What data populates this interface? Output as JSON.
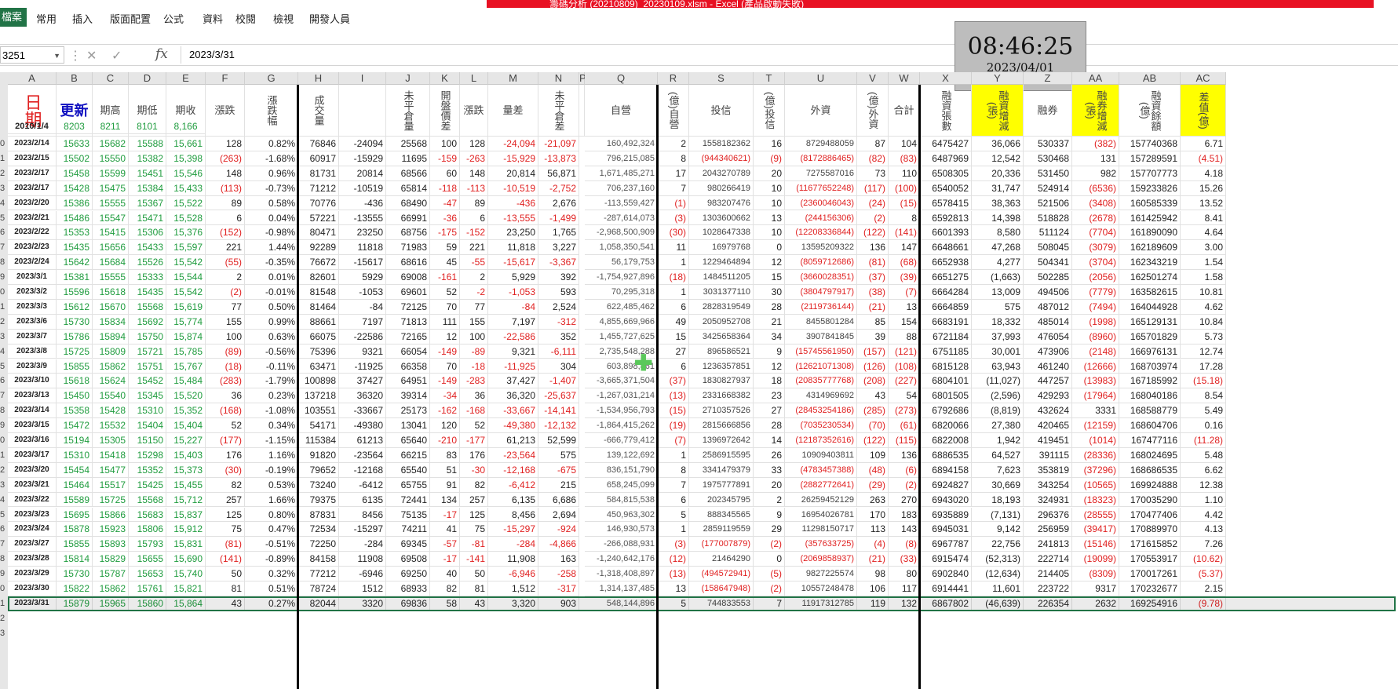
{
  "window": {
    "title": "籌碼分析 (20210809)_20230109.xlsm - Excel (產品啟動失敗)"
  },
  "ribbon": {
    "file": "檔案",
    "tabs": [
      "常用",
      "插入",
      "版面配置",
      "公式",
      "資料",
      "校閱",
      "檢視",
      "開發人員"
    ]
  },
  "formula_bar": {
    "name_box": "3251",
    "value": "2023/3/31",
    "fx": "fx"
  },
  "clock": {
    "time": "08:46:25",
    "date": "2023/04/01"
  },
  "columns": [
    "A",
    "B",
    "C",
    "D",
    "E",
    "F",
    "G",
    "H",
    "I",
    "J",
    "K",
    "L",
    "M",
    "N",
    "P",
    "Q",
    "R",
    "S",
    "T",
    "U",
    "V",
    "W",
    "X",
    "Y",
    "Z",
    "AA",
    "AB",
    "AC"
  ],
  "headers": {
    "A": "日期",
    "B": "更新",
    "C": "期高",
    "D": "期低",
    "E": "期收",
    "F": "漲跌",
    "G": "漲跌幅",
    "H": "成交量",
    "I": "",
    "J": "未平倉量",
    "K": "開盤價差",
    "L": "漲跌",
    "M": "量差",
    "N": "未平倉差",
    "Q": "自營",
    "R": "(億)自營",
    "S": "投信",
    "T": "(億)投信",
    "U": "外資",
    "V": "(億)外資",
    "W": "合計",
    "X": "融資張數",
    "Y": "融資增減(張)",
    "Z": "融券",
    "AA": "融券增減(張)",
    "AB": "融資餘額(億)",
    "AC": "差值(億)"
  },
  "base_row": {
    "date": "2010/1/4",
    "B": "8203",
    "C": "8211",
    "D": "8101",
    "E": "8,166"
  },
  "rows": [
    {
      "n": "0",
      "d": "2023/2/14",
      "v": [
        "15633",
        "15682",
        "15588",
        "15,661",
        "128",
        "0.82%",
        "76846",
        "-24094",
        "25568",
        "100",
        "128",
        "-24,094",
        "-21,097",
        "160,492,324",
        "2",
        "1558182362",
        "16",
        "8729488059",
        "87",
        "104",
        "6475427",
        "36,066",
        "530337",
        "(382)",
        "157740368",
        "6.71"
      ]
    },
    {
      "n": "1",
      "d": "2023/2/15",
      "v": [
        "15502",
        "15550",
        "15382",
        "15,398",
        "(263)",
        "-1.68%",
        "60917",
        "-15929",
        "11695",
        "-159",
        "-263",
        "-15,929",
        "-13,873",
        "796,215,085",
        "8",
        "(944340621)",
        "(9)",
        "(8172886465)",
        "(82)",
        "(83)",
        "6487969",
        "12,542",
        "530468",
        "131",
        "157289591",
        "(4.51)"
      ]
    },
    {
      "n": "2",
      "d": "2023/2/17",
      "v": [
        "15458",
        "15599",
        "15451",
        "15,546",
        "148",
        "0.96%",
        "81731",
        "20814",
        "68566",
        "60",
        "148",
        "20,814",
        "56,871",
        "1,671,485,271",
        "17",
        "2043270789",
        "20",
        "7275587016",
        "73",
        "110",
        "6508305",
        "20,336",
        "531450",
        "982",
        "157707773",
        "4.18"
      ]
    },
    {
      "n": "3",
      "d": "2023/2/17",
      "v": [
        "15428",
        "15475",
        "15384",
        "15,433",
        "(113)",
        "-0.73%",
        "71212",
        "-10519",
        "65814",
        "-118",
        "-113",
        "-10,519",
        "-2,752",
        "706,237,160",
        "7",
        "980266419",
        "10",
        "(11677652248)",
        "(117)",
        "(100)",
        "6540052",
        "31,747",
        "524914",
        "(6536)",
        "159233826",
        "15.26"
      ]
    },
    {
      "n": "4",
      "d": "2023/2/20",
      "v": [
        "15386",
        "15555",
        "15367",
        "15,522",
        "89",
        "0.58%",
        "70776",
        "-436",
        "68490",
        "-47",
        "89",
        "-436",
        "2,676",
        "-113,559,427",
        "(1)",
        "983207476",
        "10",
        "(2360046043)",
        "(24)",
        "(15)",
        "6578415",
        "38,363",
        "521506",
        "(3408)",
        "160585339",
        "13.52"
      ]
    },
    {
      "n": "5",
      "d": "2023/2/21",
      "v": [
        "15486",
        "15547",
        "15471",
        "15,528",
        "6",
        "0.04%",
        "57221",
        "-13555",
        "66991",
        "-36",
        "6",
        "-13,555",
        "-1,499",
        "-287,614,073",
        "(3)",
        "1303600662",
        "13",
        "(244156306)",
        "(2)",
        "8",
        "6592813",
        "14,398",
        "518828",
        "(2678)",
        "161425942",
        "8.41"
      ]
    },
    {
      "n": "6",
      "d": "2023/2/22",
      "v": [
        "15353",
        "15415",
        "15306",
        "15,376",
        "(152)",
        "-0.98%",
        "80471",
        "23250",
        "68756",
        "-175",
        "-152",
        "23,250",
        "1,765",
        "-2,968,500,909",
        "(30)",
        "1028647338",
        "10",
        "(12208336844)",
        "(122)",
        "(141)",
        "6601393",
        "8,580",
        "511124",
        "(7704)",
        "161890090",
        "4.64"
      ]
    },
    {
      "n": "7",
      "d": "2023/2/23",
      "v": [
        "15435",
        "15656",
        "15433",
        "15,597",
        "221",
        "1.44%",
        "92289",
        "11818",
        "71983",
        "59",
        "221",
        "11,818",
        "3,227",
        "1,058,350,541",
        "11",
        "16979768",
        "0",
        "13595209322",
        "136",
        "147",
        "6648661",
        "47,268",
        "508045",
        "(3079)",
        "162189609",
        "3.00"
      ]
    },
    {
      "n": "8",
      "d": "2023/2/24",
      "v": [
        "15642",
        "15684",
        "15526",
        "15,542",
        "(55)",
        "-0.35%",
        "76672",
        "-15617",
        "68616",
        "45",
        "-55",
        "-15,617",
        "-3,367",
        "56,179,753",
        "1",
        "1229464894",
        "12",
        "(8059712686)",
        "(81)",
        "(68)",
        "6652938",
        "4,277",
        "504341",
        "(3704)",
        "162343219",
        "1.54"
      ]
    },
    {
      "n": "9",
      "d": "2023/3/1",
      "v": [
        "15381",
        "15555",
        "15333",
        "15,544",
        "2",
        "0.01%",
        "82601",
        "5929",
        "69008",
        "-161",
        "2",
        "5,929",
        "392",
        "-1,754,927,896",
        "(18)",
        "1484511205",
        "15",
        "(3660028351)",
        "(37)",
        "(39)",
        "6651275",
        "(1,663)",
        "502285",
        "(2056)",
        "162501274",
        "1.58"
      ]
    },
    {
      "n": "0",
      "d": "2023/3/2",
      "v": [
        "15596",
        "15618",
        "15435",
        "15,542",
        "(2)",
        "-0.01%",
        "81548",
        "-1053",
        "69601",
        "52",
        "-2",
        "-1,053",
        "593",
        "70,295,318",
        "1",
        "3031377110",
        "30",
        "(3804797917)",
        "(38)",
        "(7)",
        "6664284",
        "13,009",
        "494506",
        "(7779)",
        "163582615",
        "10.81"
      ]
    },
    {
      "n": "1",
      "d": "2023/3/3",
      "v": [
        "15612",
        "15670",
        "15568",
        "15,619",
        "77",
        "0.50%",
        "81464",
        "-84",
        "72125",
        "70",
        "77",
        "-84",
        "2,524",
        "622,485,462",
        "6",
        "2828319549",
        "28",
        "(2119736144)",
        "(21)",
        "13",
        "6664859",
        "575",
        "487012",
        "(7494)",
        "164044928",
        "4.62"
      ]
    },
    {
      "n": "2",
      "d": "2023/3/6",
      "v": [
        "15730",
        "15834",
        "15692",
        "15,774",
        "155",
        "0.99%",
        "88661",
        "7197",
        "71813",
        "111",
        "155",
        "7,197",
        "-312",
        "4,855,669,966",
        "49",
        "2050952708",
        "21",
        "8455801284",
        "85",
        "154",
        "6683191",
        "18,332",
        "485014",
        "(1998)",
        "165129131",
        "10.84"
      ]
    },
    {
      "n": "3",
      "d": "2023/3/7",
      "v": [
        "15786",
        "15894",
        "15750",
        "15,874",
        "100",
        "0.63%",
        "66075",
        "-22586",
        "72165",
        "12",
        "100",
        "-22,586",
        "352",
        "1,455,727,625",
        "15",
        "3425658364",
        "34",
        "3907841845",
        "39",
        "88",
        "6721184",
        "37,993",
        "476054",
        "(8960)",
        "165701829",
        "5.73"
      ]
    },
    {
      "n": "4",
      "d": "2023/3/8",
      "v": [
        "15725",
        "15809",
        "15721",
        "15,785",
        "(89)",
        "-0.56%",
        "75396",
        "9321",
        "66054",
        "-149",
        "-89",
        "9,321",
        "-6,111",
        "2,735,548,288",
        "27",
        "896586521",
        "9",
        "(15745561950)",
        "(157)",
        "(121)",
        "6751185",
        "30,001",
        "473906",
        "(2148)",
        "166976131",
        "12.74"
      ]
    },
    {
      "n": "5",
      "d": "2023/3/9",
      "v": [
        "15855",
        "15862",
        "15751",
        "15,767",
        "(18)",
        "-0.11%",
        "63471",
        "-11925",
        "66358",
        "70",
        "-18",
        "-11,925",
        "304",
        "603,898,861",
        "6",
        "1236357851",
        "12",
        "(12621071308)",
        "(126)",
        "(108)",
        "6815128",
        "63,943",
        "461240",
        "(12666)",
        "168703974",
        "17.28"
      ]
    },
    {
      "n": "6",
      "d": "2023/3/10",
      "v": [
        "15618",
        "15624",
        "15452",
        "15,484",
        "(283)",
        "-1.79%",
        "100898",
        "37427",
        "64951",
        "-149",
        "-283",
        "37,427",
        "-1,407",
        "-3,665,371,504",
        "(37)",
        "1830827937",
        "18",
        "(20835777768)",
        "(208)",
        "(227)",
        "6804101",
        "(11,027)",
        "447257",
        "(13983)",
        "167185992",
        "(15.18)"
      ]
    },
    {
      "n": "7",
      "d": "2023/3/13",
      "v": [
        "15450",
        "15540",
        "15345",
        "15,520",
        "36",
        "0.23%",
        "137218",
        "36320",
        "39314",
        "-34",
        "36",
        "36,320",
        "-25,637",
        "-1,267,031,214",
        "(13)",
        "2331668382",
        "23",
        "4314969692",
        "43",
        "54",
        "6801505",
        "(2,596)",
        "429293",
        "(17964)",
        "168040186",
        "8.54"
      ]
    },
    {
      "n": "8",
      "d": "2023/3/14",
      "v": [
        "15358",
        "15428",
        "15310",
        "15,352",
        "(168)",
        "-1.08%",
        "103551",
        "-33667",
        "25173",
        "-162",
        "-168",
        "-33,667",
        "-14,141",
        "-1,534,956,793",
        "(15)",
        "2710357526",
        "27",
        "(28453254186)",
        "(285)",
        "(273)",
        "6792686",
        "(8,819)",
        "432624",
        "3331",
        "168588779",
        "5.49"
      ]
    },
    {
      "n": "9",
      "d": "2023/3/15",
      "v": [
        "15472",
        "15532",
        "15404",
        "15,404",
        "52",
        "0.34%",
        "54171",
        "-49380",
        "13041",
        "120",
        "52",
        "-49,380",
        "-12,132",
        "-1,864,415,262",
        "(19)",
        "2815666856",
        "28",
        "(7035230534)",
        "(70)",
        "(61)",
        "6820066",
        "27,380",
        "420465",
        "(12159)",
        "168604706",
        "0.16"
      ]
    },
    {
      "n": "0",
      "d": "2023/3/16",
      "v": [
        "15194",
        "15305",
        "15150",
        "15,227",
        "(177)",
        "-1.15%",
        "115384",
        "61213",
        "65640",
        "-210",
        "-177",
        "61,213",
        "52,599",
        "-666,779,412",
        "(7)",
        "1396972642",
        "14",
        "(12187352616)",
        "(122)",
        "(115)",
        "6822008",
        "1,942",
        "419451",
        "(1014)",
        "167477116",
        "(11.28)"
      ]
    },
    {
      "n": "1",
      "d": "2023/3/17",
      "v": [
        "15310",
        "15418",
        "15298",
        "15,403",
        "176",
        "1.16%",
        "91820",
        "-23564",
        "66215",
        "83",
        "176",
        "-23,564",
        "575",
        "139,122,692",
        "1",
        "2586915595",
        "26",
        "10909403811",
        "109",
        "136",
        "6886535",
        "64,527",
        "391115",
        "(28336)",
        "168024695",
        "5.48"
      ]
    },
    {
      "n": "2",
      "d": "2023/3/20",
      "v": [
        "15454",
        "15477",
        "15352",
        "15,373",
        "(30)",
        "-0.19%",
        "79652",
        "-12168",
        "65540",
        "51",
        "-30",
        "-12,168",
        "-675",
        "836,151,790",
        "8",
        "3341479379",
        "33",
        "(4783457388)",
        "(48)",
        "(6)",
        "6894158",
        "7,623",
        "353819",
        "(37296)",
        "168686535",
        "6.62"
      ]
    },
    {
      "n": "3",
      "d": "2023/3/21",
      "v": [
        "15464",
        "15517",
        "15425",
        "15,455",
        "82",
        "0.53%",
        "73240",
        "-6412",
        "65755",
        "91",
        "82",
        "-6,412",
        "215",
        "658,245,099",
        "7",
        "1975777891",
        "20",
        "(2882772641)",
        "(29)",
        "(2)",
        "6924827",
        "30,669",
        "343254",
        "(10565)",
        "169924888",
        "12.38"
      ]
    },
    {
      "n": "4",
      "d": "2023/3/22",
      "v": [
        "15589",
        "15725",
        "15568",
        "15,712",
        "257",
        "1.66%",
        "79375",
        "6135",
        "72441",
        "134",
        "257",
        "6,135",
        "6,686",
        "584,815,538",
        "6",
        "202345795",
        "2",
        "26259452129",
        "263",
        "270",
        "6943020",
        "18,193",
        "324931",
        "(18323)",
        "170035290",
        "1.10"
      ]
    },
    {
      "n": "5",
      "d": "2023/3/23",
      "v": [
        "15695",
        "15866",
        "15683",
        "15,837",
        "125",
        "0.80%",
        "87831",
        "8456",
        "75135",
        "-17",
        "125",
        "8,456",
        "2,694",
        "450,963,302",
        "5",
        "888345565",
        "9",
        "16954026781",
        "170",
        "183",
        "6935889",
        "(7,131)",
        "296376",
        "(28555)",
        "170477406",
        "4.42"
      ]
    },
    {
      "n": "6",
      "d": "2023/3/24",
      "v": [
        "15878",
        "15923",
        "15806",
        "15,912",
        "75",
        "0.47%",
        "72534",
        "-15297",
        "74211",
        "41",
        "75",
        "-15,297",
        "-924",
        "146,930,573",
        "1",
        "2859119559",
        "29",
        "11298150717",
        "113",
        "143",
        "6945031",
        "9,142",
        "256959",
        "(39417)",
        "170889970",
        "4.13"
      ]
    },
    {
      "n": "7",
      "d": "2023/3/27",
      "v": [
        "15855",
        "15893",
        "15793",
        "15,831",
        "(81)",
        "-0.51%",
        "72250",
        "-284",
        "69345",
        "-57",
        "-81",
        "-284",
        "-4,866",
        "-266,088,931",
        "(3)",
        "(177007879)",
        "(2)",
        "(357633725)",
        "(4)",
        "(8)",
        "6967787",
        "22,756",
        "241813",
        "(15146)",
        "171615852",
        "7.26"
      ]
    },
    {
      "n": "8",
      "d": "2023/3/28",
      "v": [
        "15814",
        "15829",
        "15655",
        "15,690",
        "(141)",
        "-0.89%",
        "84158",
        "11908",
        "69508",
        "-17",
        "-141",
        "11,908",
        "163",
        "-1,240,642,176",
        "(12)",
        "21464290",
        "0",
        "(2069858937)",
        "(21)",
        "(33)",
        "6915474",
        "(52,313)",
        "222714",
        "(19099)",
        "170553917",
        "(10.62)"
      ]
    },
    {
      "n": "9",
      "d": "2023/3/29",
      "v": [
        "15730",
        "15787",
        "15653",
        "15,740",
        "50",
        "0.32%",
        "77212",
        "-6946",
        "69250",
        "40",
        "50",
        "-6,946",
        "-258",
        "-1,318,408,897",
        "(13)",
        "(494572941)",
        "(5)",
        "9827225574",
        "98",
        "80",
        "6902840",
        "(12,634)",
        "214405",
        "(8309)",
        "170017261",
        "(5.37)"
      ]
    },
    {
      "n": "0",
      "d": "2023/3/30",
      "v": [
        "15822",
        "15862",
        "15761",
        "15,821",
        "81",
        "0.51%",
        "78724",
        "1512",
        "68933",
        "82",
        "81",
        "1,512",
        "-317",
        "1,314,137,485",
        "13",
        "(158647948)",
        "(2)",
        "10557248478",
        "106",
        "117",
        "6914441",
        "11,601",
        "223722",
        "9317",
        "170232677",
        "2.15"
      ]
    },
    {
      "n": "1",
      "d": "2023/3/31",
      "v": [
        "15879",
        "15965",
        "15860",
        "15,864",
        "43",
        "0.27%",
        "82044",
        "3320",
        "69836",
        "58",
        "43",
        "3,320",
        "903",
        "548,144,896",
        "5",
        "744833553",
        "7",
        "11917312785",
        "119",
        "132",
        "6867802",
        "(46,639)",
        "226354",
        "2632",
        "169254916",
        "(9.78)"
      ]
    }
  ],
  "tail_rows": [
    "2",
    "3"
  ],
  "colors": {
    "green": "#1f9c3e",
    "red": "#e02020",
    "excel_green": "#217346",
    "highlight": "#ffff00",
    "title_red": "#e81123"
  }
}
